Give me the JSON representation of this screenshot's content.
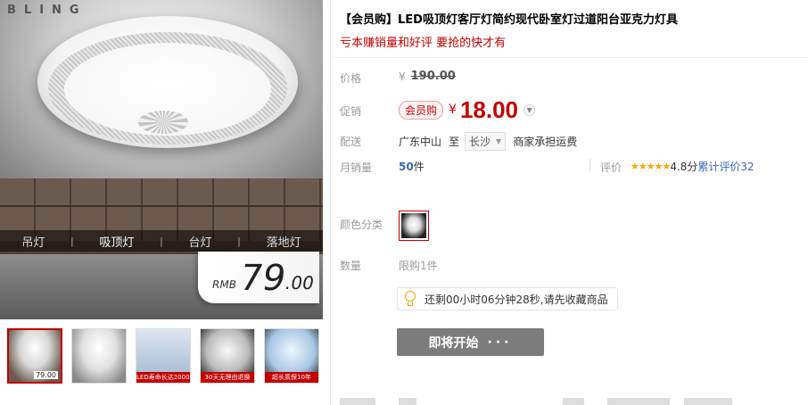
{
  "gallery": {
    "brand": "BLING",
    "categories": [
      "吊灯",
      "吸顶灯",
      "台灯",
      "落地灯"
    ],
    "separator": "|",
    "price_badge": {
      "prefix": "RMB",
      "integer": "79",
      "decimal": ".00"
    },
    "thumbnails": [
      {
        "caption": "",
        "price": "79.00"
      },
      {
        "caption": "",
        "price": ""
      },
      {
        "caption": "LED寿命长达20000小时",
        "price": ""
      },
      {
        "caption": "30天无理由退换",
        "price": ""
      },
      {
        "caption": "超长质保10年",
        "price": ""
      }
    ]
  },
  "product": {
    "title": "【会员购】LED吸顶灯客厅灯简约现代卧室灯过道阳台亚克力灯具",
    "subtitle": "亏本赚销量和好评 要抢的快才有",
    "price_label": "价格",
    "currency": "¥",
    "original_price": "190.00",
    "promo_label": "促销",
    "promo_tag": "会员购",
    "promo_price": "18.00",
    "shipping_label": "配送",
    "ship_from": "广东中山",
    "ship_to_word": "至",
    "ship_to": "长沙",
    "shipping_fee": "商家承担运费",
    "sales_label": "月销量",
    "sales_count": "50",
    "sales_unit": "件",
    "review_label": "评价",
    "stars": "★★★★★",
    "score": "4.8分",
    "review_total": "累计评价32",
    "color_label": "颜色分类",
    "qty_label": "数量",
    "qty_limit": "限购1件",
    "countdown": "还剩00小时06分钟28秒,请先收藏商品",
    "button_label": "即将开始",
    "button_dots": "···"
  },
  "colors": {
    "accent": "#c40000",
    "link": "#3a6ab0",
    "star": "#ffa500",
    "button": "#7c7c7c"
  }
}
